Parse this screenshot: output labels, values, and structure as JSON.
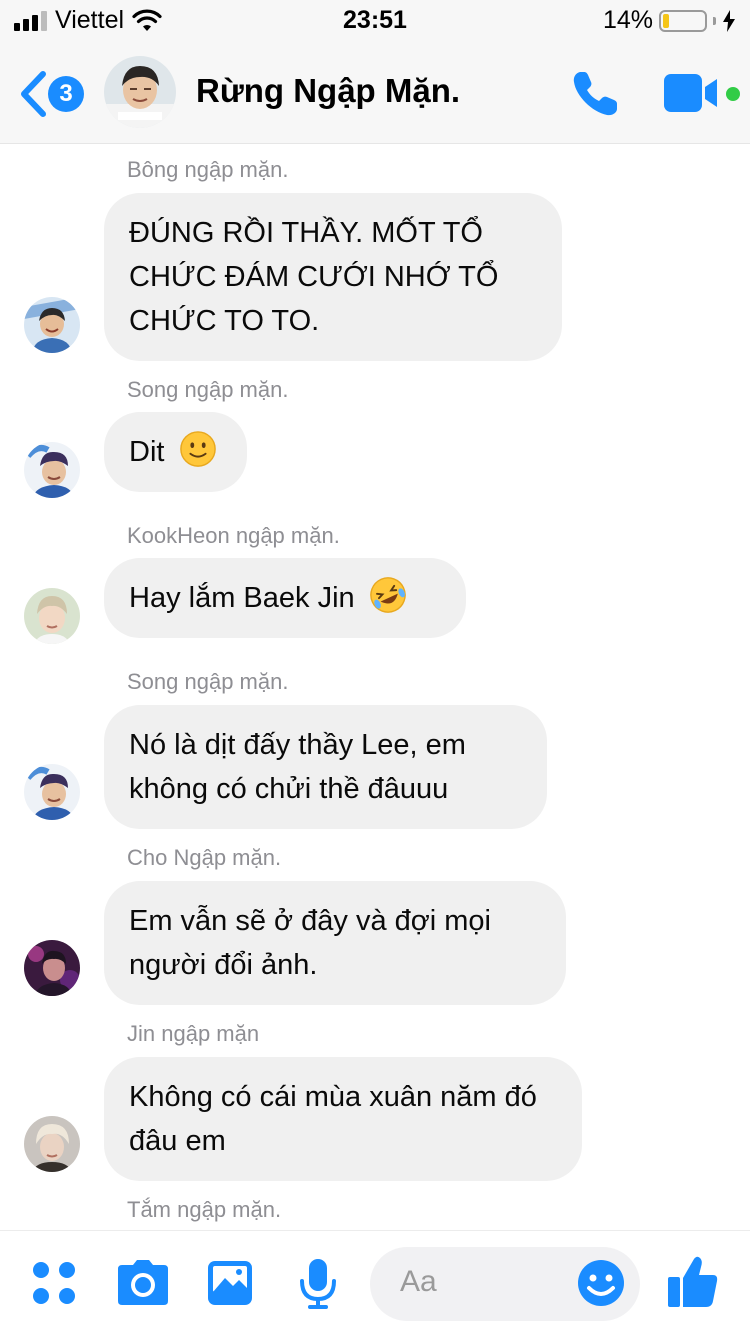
{
  "status_bar": {
    "carrier": "Viettel",
    "time": "23:51",
    "battery_pct_text": "14%",
    "battery_level": 0.14,
    "signal_bars": 3
  },
  "header": {
    "back_badge": "3",
    "title": "Rừng Ngập Mặn.",
    "accent_color": "#1a8cff"
  },
  "messages": [
    {
      "sender": "Bông ngập mặn.",
      "text": "ĐÚNG RỒI THẦY. MỐT TỔ CHỨC ĐÁM CƯỚI NHỚ TỔ CHỨC TO TO."
    },
    {
      "sender": "Song ngập mặn.",
      "text": "Dit",
      "emoji": "slightly-smiling-face-emoji"
    },
    {
      "sender": "KookHeon ngập mặn.",
      "text": "Hay lắm Baek Jin",
      "emoji": "rofl-face-emoji"
    },
    {
      "sender": "Song ngập mặn.",
      "text": "Nó là dịt đấy thầy Lee, em không có chửi thề đâuuu"
    },
    {
      "sender": "Cho Ngập mặn.",
      "text": "Em vẫn sẽ ở đây và đợi mọi người đổi ảnh."
    },
    {
      "sender": "Jin ngập mặn",
      "text": "Không có cái mùa xuân năm đó đâu em"
    },
    {
      "sender": "Tắm ngập mặn."
    }
  ],
  "composer": {
    "placeholder": "Aa",
    "icons": [
      "apps-icon",
      "camera-icon",
      "gallery-icon",
      "microphone-icon",
      "emoji-icon",
      "thumbs-up-icon"
    ]
  }
}
